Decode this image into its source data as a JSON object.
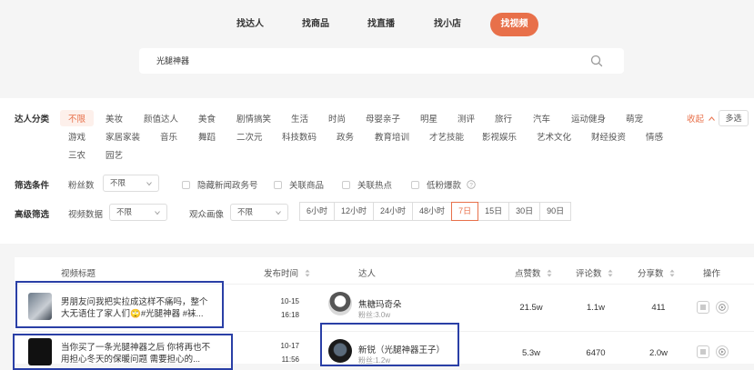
{
  "nav": {
    "tabs": [
      "找达人",
      "找商品",
      "找直播",
      "找小店",
      "找视频"
    ],
    "active": 4
  },
  "search": {
    "value": "光腿神器",
    "icon": "search-icon"
  },
  "filters": {
    "category_label": "达人分类",
    "categories_row1": [
      "不限",
      "美妆",
      "颜值达人",
      "美食",
      "剧情搞笑",
      "生活",
      "时尚",
      "母婴亲子",
      "明星",
      "测评",
      "旅行",
      "汽车",
      "运动健身",
      "萌宠"
    ],
    "categories_row2": [
      "游戏",
      "家居家装",
      "音乐",
      "舞蹈",
      "二次元",
      "科技数码",
      "政务",
      "教育培训",
      "才艺技能",
      "影视娱乐",
      "艺术文化",
      "财经投资",
      "情感"
    ],
    "categories_row3": [
      "三农",
      "园艺"
    ],
    "fold": "收起",
    "multi": "多选",
    "screen_label": "筛选条件",
    "fans_label": "粉丝数",
    "fans_value": "不限",
    "checkboxes": [
      "隐藏新闻政务号",
      "关联商品",
      "关联热点",
      "低粉爆款"
    ],
    "advanced_label": "高级筛选",
    "video_data_label": "视频数据",
    "video_data_value": "不限",
    "audience_label": "观众画像",
    "audience_value": "不限",
    "time_ranges": [
      "6小时",
      "12小时",
      "24小时",
      "48小时",
      "7日",
      "15日",
      "30日",
      "90日"
    ],
    "time_active": 4
  },
  "table": {
    "headers": {
      "title": "视频标题",
      "time": "发布时间",
      "creator": "达人",
      "likes": "点赞数",
      "comments": "评论数",
      "shares": "分享数",
      "actions": "操作"
    },
    "rows": [
      {
        "title": "男朋友问我把实拉成这样不痛吗，整个大无语住了家人们🙄#光腿神器 #袜...",
        "date": "10-15",
        "time": "16:18",
        "creator": "焦糖玛奇朵",
        "fans": "粉丝:3.0w",
        "likes": "21.5w",
        "comments": "1.1w",
        "shares": "411"
      },
      {
        "title": "当你买了一条光腿神器之后 你将再也不用担心冬天的保暖问题 需要担心的...",
        "date": "10-17",
        "time": "11:56",
        "creator": "新锐（光腿神器王子）",
        "fans": "粉丝:1.2w",
        "likes": "5.3w",
        "comments": "6470",
        "shares": "2.0w"
      }
    ]
  },
  "colors": {
    "accent": "#e8704a",
    "highlight": "#2a3fa6"
  }
}
